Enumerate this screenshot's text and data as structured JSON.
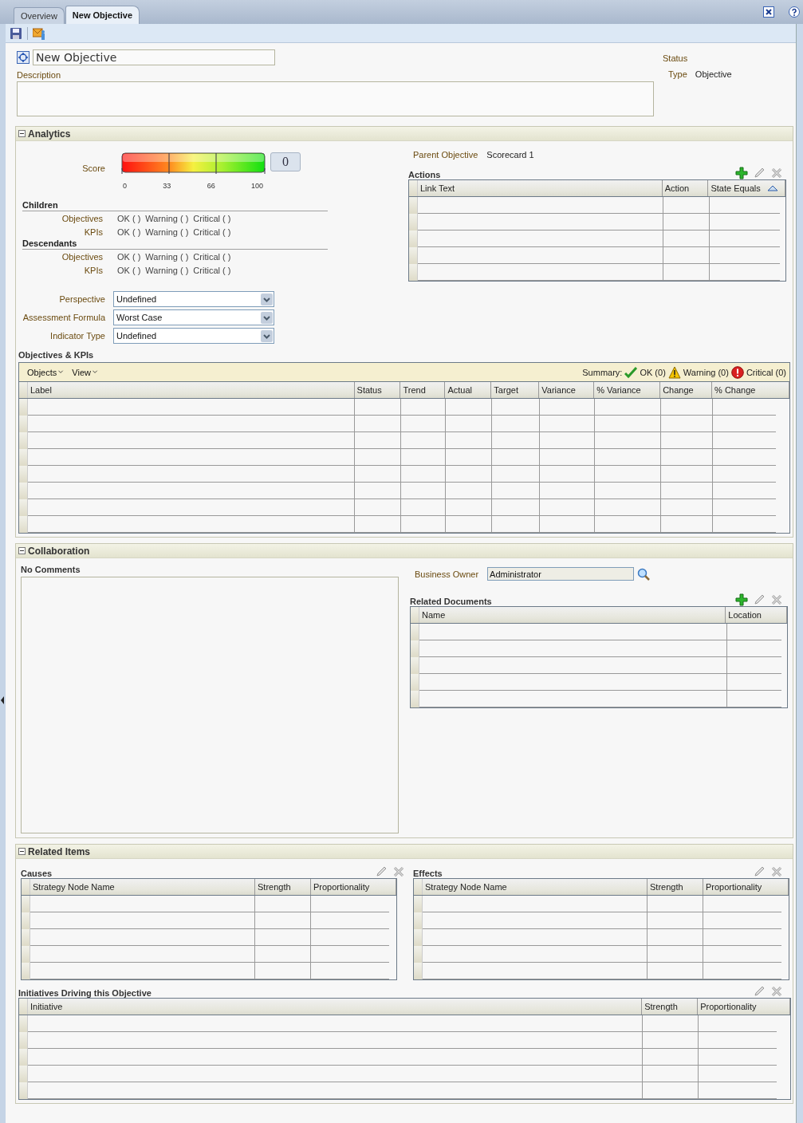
{
  "tabs": [
    {
      "label": "Overview",
      "selected": false
    },
    {
      "label": "New Objective",
      "selected": true
    }
  ],
  "header": {
    "title_value": "New Objective",
    "description_label": "Description",
    "status_label": "Status",
    "type_label": "Type",
    "type_value": "Objective"
  },
  "analytics": {
    "title": "Analytics",
    "expanded": true,
    "score": {
      "label": "Score",
      "ticks": [
        "0",
        "33",
        "66",
        "100"
      ],
      "value": "0"
    },
    "groups": [
      {
        "heading": "Children",
        "rows": [
          {
            "label": "Objectives",
            "ok": "OK ( )",
            "warning": "Warning ( )",
            "critical": "Critical ( )"
          },
          {
            "label": "KPIs",
            "ok": "OK ( )",
            "warning": "Warning ( )",
            "critical": "Critical ( )"
          }
        ]
      },
      {
        "heading": "Descendants",
        "rows": [
          {
            "label": "Objectives",
            "ok": "OK ( )",
            "warning": "Warning ( )",
            "critical": "Critical ( )"
          },
          {
            "label": "KPIs",
            "ok": "OK ( )",
            "warning": "Warning ( )",
            "critical": "Critical ( )"
          }
        ]
      }
    ],
    "selects": [
      {
        "label": "Perspective",
        "value": "Undefined"
      },
      {
        "label": "Assessment Formula",
        "value": "Worst Case"
      },
      {
        "label": "Indicator Type",
        "value": "Undefined"
      }
    ],
    "parent": {
      "label": "Parent Objective",
      "value": "Scorecard 1"
    },
    "actions": {
      "title": "Actions",
      "columns": [
        {
          "label": "Link Text",
          "sorted": false
        },
        {
          "label": "Action",
          "sorted": false
        },
        {
          "label": "State Equals",
          "sorted": true
        }
      ]
    },
    "objectives_kpis": {
      "title": "Objectives & KPIs",
      "menus": [
        "Objects",
        "View"
      ],
      "summary_label": "Summary:",
      "summary": [
        {
          "kind": "ok",
          "text": "OK (0)"
        },
        {
          "kind": "warning",
          "text": "Warning (0)"
        },
        {
          "kind": "critical",
          "text": "Critical (0)"
        }
      ],
      "columns": [
        "Label",
        "Status",
        "Trend",
        "Actual",
        "Target",
        "Variance",
        "% Variance",
        "Change",
        "% Change"
      ]
    }
  },
  "collaboration": {
    "title": "Collaboration",
    "expanded": true,
    "comments_heading": "No Comments",
    "owner": {
      "label": "Business Owner",
      "value": "Administrator"
    },
    "documents": {
      "title": "Related Documents",
      "columns": [
        "Name",
        "Location"
      ]
    }
  },
  "related_items": {
    "title": "Related Items",
    "expanded": true,
    "causes": {
      "title": "Causes",
      "columns": [
        "Strategy Node Name",
        "Strength",
        "Proportionality"
      ]
    },
    "effects": {
      "title": "Effects",
      "columns": [
        "Strategy Node Name",
        "Strength",
        "Proportionality"
      ]
    },
    "initiatives": {
      "title": "Initiatives Driving this Objective",
      "columns": [
        "Initiative",
        "Strength",
        "Proportionality"
      ]
    }
  }
}
